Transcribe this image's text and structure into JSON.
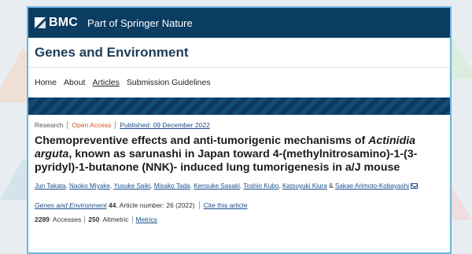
{
  "brand": {
    "logo_text": "BMC",
    "tagline": "Part of Springer Nature"
  },
  "journal": {
    "title": "Genes and Environment"
  },
  "nav": {
    "items": [
      {
        "label": "Home"
      },
      {
        "label": "About"
      },
      {
        "label": "Articles"
      },
      {
        "label": "Submission Guidelines"
      }
    ],
    "active": "Articles"
  },
  "article": {
    "type": "Research",
    "access": "Open Access",
    "published": "Published: 09 December 2022",
    "title_part1": "Chemopreventive effects and anti-tumorigenic mechanisms of ",
    "title_italic": "Actinidia arguta",
    "title_part2": ", known as sarunashi in Japan toward 4-(methylnitrosamino)-1-(3-pyridyl)-1-butanone (NNK)- induced lung tumorigenesis in a/J mouse",
    "authors": [
      "Jun Takata",
      "Naoko Miyake",
      "Yusuke Saiki",
      "Misako Tada",
      "Kensuke Sasaki",
      "Toshio Kubo",
      "Katsuyuki Kiura",
      "Sakae Arimoto-Kobayashi"
    ],
    "author_sep": ",",
    "author_amp": "&",
    "citation": {
      "journal": "Genes and Environment",
      "volume": "44",
      "article_number": ", Article number: 26 (2022)",
      "cite_link": "Cite this article"
    },
    "metrics": {
      "accesses_value": "2289",
      "accesses_label": "Accesses",
      "altmetric_value": "250",
      "altmetric_label": "Altmetric",
      "metrics_link": "Metrics"
    }
  },
  "colors": {
    "brand_bar": "#0b3c61",
    "frame_border": "#6fb4e0",
    "link": "#1a4d8c",
    "open_access": "#d4592a"
  },
  "icons": [
    "bmc-logo-icon",
    "mail-icon"
  ]
}
